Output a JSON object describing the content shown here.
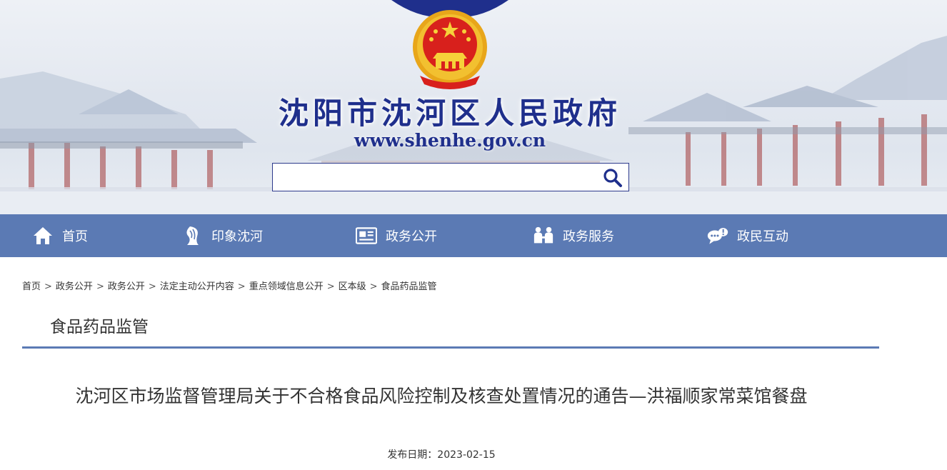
{
  "header": {
    "site_title": "沈阳市沈河区人民政府",
    "site_url": "www.shenhe.gov.cn",
    "search": {
      "placeholder": "",
      "value": ""
    }
  },
  "nav": {
    "items": [
      {
        "label": "首页",
        "icon": "home-icon"
      },
      {
        "label": "印象沈河",
        "icon": "impression-icon"
      },
      {
        "label": "政务公开",
        "icon": "newspaper-icon"
      },
      {
        "label": "政务服务",
        "icon": "service-icon"
      },
      {
        "label": "政民互动",
        "icon": "chat-icon"
      }
    ]
  },
  "breadcrumb": {
    "items": [
      "首页",
      "政务公开",
      "政务公开",
      "法定主动公开内容",
      "重点领域信息公开",
      "区本级",
      "食品药品监管"
    ],
    "separator": ">"
  },
  "section": {
    "title": "食品药品监管"
  },
  "article": {
    "title": "沈河区市场监督管理局关于不合格食品风险控制及核查处置情况的通告—洪福顺家常菜馆餐盘",
    "publish_date_label": "发布日期：2023-02-15"
  },
  "colors": {
    "nav_bg": "#5b7ab4",
    "title_blue": "#1f2f8c",
    "emblem_red": "#d8201c",
    "emblem_gold": "#f2b41a"
  }
}
